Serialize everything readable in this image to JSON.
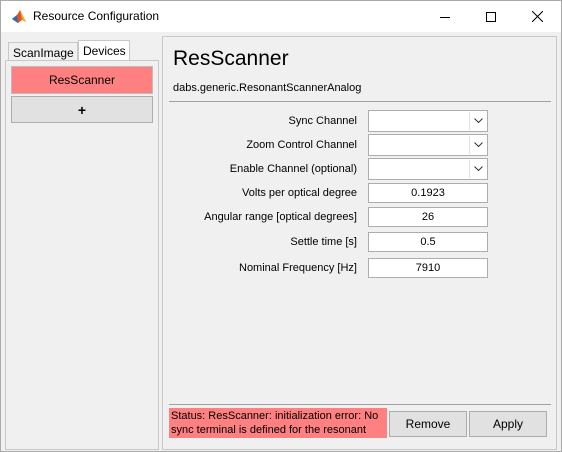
{
  "window": {
    "title": "Resource Configuration",
    "icon": "matlab-icon"
  },
  "tabs": [
    {
      "label": "ScanImage",
      "selected": false
    },
    {
      "label": "Devices",
      "selected": true
    }
  ],
  "device_list": {
    "items": [
      {
        "label": "ResScanner",
        "color": "#ff8080",
        "selected": true
      }
    ],
    "add_label": "+"
  },
  "device": {
    "title": "ResScanner",
    "class_name": "dabs.generic.ResonantScannerAnalog"
  },
  "fields": {
    "sync_channel": {
      "label": "Sync Channel",
      "value": ""
    },
    "zoom_channel": {
      "label": "Zoom Control Channel",
      "value": ""
    },
    "enable_channel": {
      "label": "Enable Channel (optional)",
      "value": ""
    },
    "volts_per_degree": {
      "label": "Volts per optical degree",
      "value": "0.1923"
    },
    "angular_range": {
      "label": "Angular range [optical degrees]",
      "value": "26"
    },
    "settle_time": {
      "label": "Settle time [s]",
      "value": "0.5"
    },
    "nominal_frequency": {
      "label": "Nominal Frequency [Hz]",
      "value": "7910"
    }
  },
  "status": {
    "text": "Status: ResScanner: initialization error: No sync terminal is defined for the resonant",
    "color": "#ff8080"
  },
  "actions": {
    "remove_label": "Remove",
    "apply_label": "Apply"
  }
}
